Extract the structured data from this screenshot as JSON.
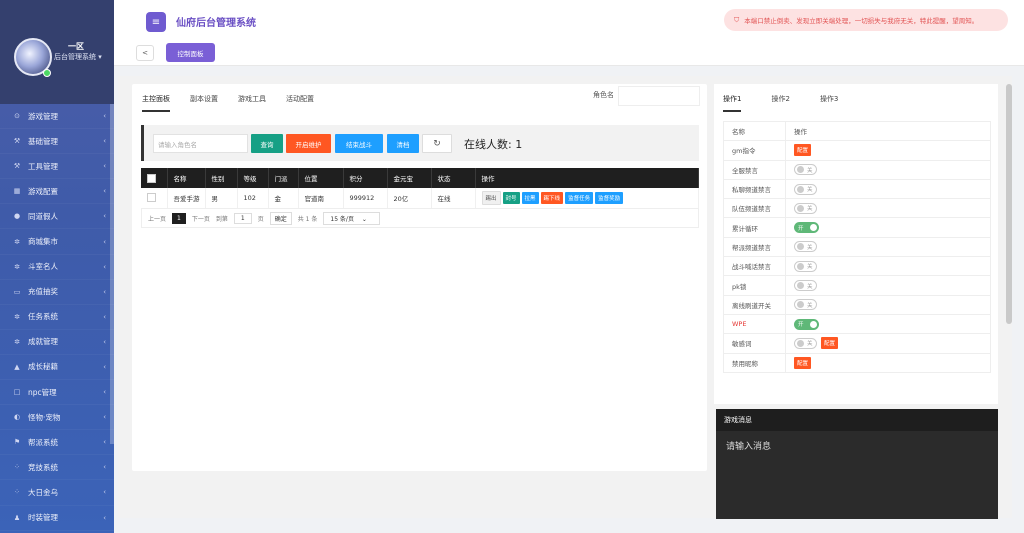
{
  "sidebar": {
    "user_name": "一区",
    "user_role": "后台管理系统",
    "items": [
      {
        "icon": "gamepad-icon",
        "glyph": "⊙",
        "label": "游戏管理"
      },
      {
        "icon": "tool-icon",
        "glyph": "⚒",
        "label": "基础管理"
      },
      {
        "icon": "tool-icon",
        "glyph": "⚒",
        "label": "工具管理"
      },
      {
        "icon": "grid-icon",
        "glyph": "▦",
        "label": "游戏配置"
      },
      {
        "icon": "user-icon",
        "glyph": "●",
        "label": "同道假人"
      },
      {
        "icon": "star-icon",
        "glyph": "✲",
        "label": "商城集市"
      },
      {
        "icon": "star-icon",
        "glyph": "✲",
        "label": "斗室名人"
      },
      {
        "icon": "card-icon",
        "glyph": "▭",
        "label": "充值抽奖"
      },
      {
        "icon": "star-icon",
        "glyph": "✲",
        "label": "任务系统"
      },
      {
        "icon": "star-icon",
        "glyph": "✲",
        "label": "成就管理"
      },
      {
        "icon": "chart-icon",
        "glyph": "▲",
        "label": "成长秘籍"
      },
      {
        "icon": "square-icon",
        "glyph": "□",
        "label": "npc管理"
      },
      {
        "icon": "half-circle-icon",
        "glyph": "◐",
        "label": "怪物·宠物"
      },
      {
        "icon": "flag-icon",
        "glyph": "⚑",
        "label": "帮派系统"
      },
      {
        "icon": "share-icon",
        "glyph": "⁘",
        "label": "竞技系统"
      },
      {
        "icon": "share-icon",
        "glyph": "⁘",
        "label": "大日金乌"
      },
      {
        "icon": "people-icon",
        "glyph": "♟",
        "label": "时装管理"
      }
    ]
  },
  "header": {
    "title": "仙府后台管理系统",
    "notice": "本端口禁止倒卖、发现立即关端处理，一切损失与我府无关，特此提醒，望周知。",
    "back": "<",
    "active_tab": "控制面板"
  },
  "main": {
    "tabs": [
      "主控面板",
      "副本设置",
      "游戏工具",
      "活动配置"
    ],
    "role_label": "角色名",
    "search_placeholder": "请输入角色名",
    "buttons": {
      "query": "查询",
      "maintenance": "开启维护",
      "end_battle": "结束战斗",
      "clear": "清档"
    },
    "online_count": "在线人数: 1",
    "table": {
      "headers": [
        "名称",
        "性别",
        "等级",
        "门派",
        "位置",
        "积分",
        "金元宝",
        "状态",
        "操作"
      ],
      "row": {
        "name": "吾爱手游",
        "gender": "男",
        "level": "102",
        "sect": "金",
        "location": "官道南",
        "points": "999912",
        "gold": "20亿",
        "status": "在线",
        "ops": [
          "踢出",
          "封号",
          "拉黑",
          "踢下线",
          "监督任务",
          "监督奖励"
        ]
      }
    },
    "pager": {
      "prev": "上一页",
      "current": "1",
      "next": "下一页",
      "goto": "到第",
      "page_value": "1",
      "page_unit": "页",
      "confirm": "确定",
      "total": "共 1 条",
      "per_page": "15 条/页"
    }
  },
  "right": {
    "tabs": [
      "操作1",
      "操作2",
      "操作3"
    ],
    "header": {
      "name": "名称",
      "op": "操作"
    },
    "rows": [
      {
        "name": "gm指令",
        "control": "config",
        "config_label": "配置"
      },
      {
        "name": "全服禁言",
        "control": "off",
        "switch_label": "关"
      },
      {
        "name": "私聊频道禁言",
        "control": "off",
        "switch_label": "关"
      },
      {
        "name": "队伍频道禁言",
        "control": "off",
        "switch_label": "关"
      },
      {
        "name": "累计循环",
        "control": "on",
        "switch_label": "开"
      },
      {
        "name": "帮派频道禁言",
        "control": "off",
        "switch_label": "关"
      },
      {
        "name": "战斗喊话禁言",
        "control": "off",
        "switch_label": "关"
      },
      {
        "name": "pk锁",
        "control": "off",
        "switch_label": "关"
      },
      {
        "name": "离线刷道开关",
        "control": "off",
        "switch_label": "关"
      },
      {
        "name": "WPE",
        "control": "on",
        "switch_label": "开",
        "red": true
      },
      {
        "name": "敏感词",
        "control": "off+config",
        "switch_label": "关",
        "config_label": "配置"
      },
      {
        "name": "禁用昵称",
        "control": "config",
        "config_label": "配置"
      }
    ]
  },
  "messages": {
    "title": "游戏消息",
    "placeholder": "请输入消息"
  },
  "colors": {
    "accent": "#6f5bd0",
    "green": "#16a085",
    "orange": "#ff5722",
    "blue": "#1e9fff",
    "sidebar": "#3f5ba9"
  }
}
